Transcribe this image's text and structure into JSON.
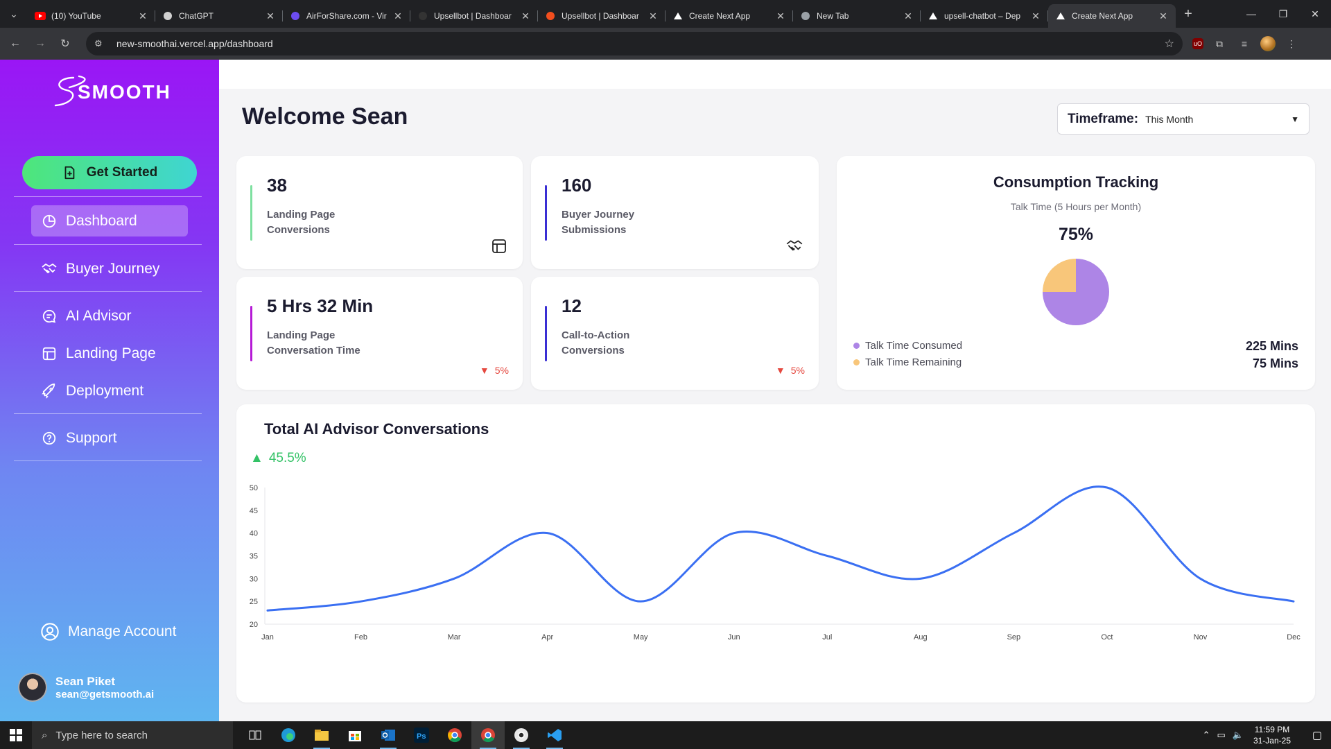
{
  "browser": {
    "tabs": [
      {
        "title": "(10) YouTube",
        "icon": "youtube-icon"
      },
      {
        "title": "ChatGPT",
        "icon": "chatgpt-icon"
      },
      {
        "title": "AirForShare.com - Vir",
        "icon": "airforshare-icon"
      },
      {
        "title": "Upsellbot | Dashboar",
        "icon": "upsellbot-icon"
      },
      {
        "title": "Upsellbot | Dashboar",
        "icon": "figma-icon"
      },
      {
        "title": "Create Next App",
        "icon": "vercel-icon"
      },
      {
        "title": "New Tab",
        "icon": "chrome-icon"
      },
      {
        "title": "upsell-chatbot – Dep",
        "icon": "vercel-icon"
      },
      {
        "title": "Create Next App",
        "icon": "vercel-icon"
      }
    ],
    "url": "new-smoothai.vercel.app/dashboard"
  },
  "sidebar": {
    "logo_text": "SMOOTH",
    "get_started": "Get Started",
    "items": [
      {
        "label": "Dashboard",
        "icon": "pie-chart-icon",
        "active": true
      },
      {
        "label": "Buyer Journey",
        "icon": "handshake-icon"
      },
      {
        "label": "AI Advisor",
        "icon": "chat-icon"
      },
      {
        "label": "Landing Page",
        "icon": "layout-icon"
      },
      {
        "label": "Deployment",
        "icon": "rocket-icon"
      },
      {
        "label": "Support",
        "icon": "help-icon"
      }
    ],
    "manage_account": "Manage Account",
    "user": {
      "name": "Sean Piket",
      "email": "sean@getsmooth.ai"
    }
  },
  "main": {
    "welcome": "Welcome Sean",
    "timeframe": {
      "label": "Timeframe:",
      "value": "This Month"
    },
    "stats": [
      {
        "value": "38",
        "label": "Landing Page Conversions",
        "accent": "#7ee0a0",
        "icon": "layout-icon"
      },
      {
        "value": "160",
        "label": "Buyer Journey Submissions",
        "accent": "#3a2fd4",
        "icon": "handshake-icon"
      },
      {
        "value": "5 Hrs 32 Min",
        "label": "Landing Page Conversation Time",
        "accent": "#b51ad6",
        "trend": "5%",
        "trend_direction": "down"
      },
      {
        "value": "12",
        "label": "Call-to-Action Conversions",
        "accent": "#3a2fd4",
        "trend": "5%",
        "trend_direction": "down"
      }
    ],
    "consumption": {
      "title": "Consumption Tracking",
      "subtitle": "Talk Time (5 Hours per Month)",
      "percent": "75%",
      "consumed_fraction": 0.75,
      "consumed_label": "Talk Time Consumed",
      "consumed_value": "225 Mins",
      "consumed_color": "#ad85e6",
      "remaining_label": "Talk Time Remaining",
      "remaining_value": "75 Mins",
      "remaining_color": "#f8c67a"
    },
    "conversations": {
      "title": "Total AI Advisor Conversations",
      "delta": "45.5%",
      "delta_color": "#33c266"
    }
  },
  "chart_data": {
    "type": "line",
    "title": "Total AI Advisor Conversations",
    "categories": [
      "Jan",
      "Feb",
      "Mar",
      "Apr",
      "May",
      "Jun",
      "Jul",
      "Aug",
      "Sep",
      "Oct",
      "Nov",
      "Dec"
    ],
    "series": [
      {
        "values": [
          23,
          25,
          30,
          40,
          25,
          40,
          35,
          30,
          40,
          50,
          30,
          25
        ],
        "color": "#3a6ff2"
      }
    ],
    "yticks": [
      20,
      25,
      30,
      35,
      40,
      45,
      50
    ],
    "ylim": [
      20,
      50
    ],
    "grid": false,
    "curve": "smooth"
  },
  "taskbar": {
    "search_placeholder": "Type here to search",
    "time": "11:59 PM",
    "date": "31-Jan-25"
  }
}
